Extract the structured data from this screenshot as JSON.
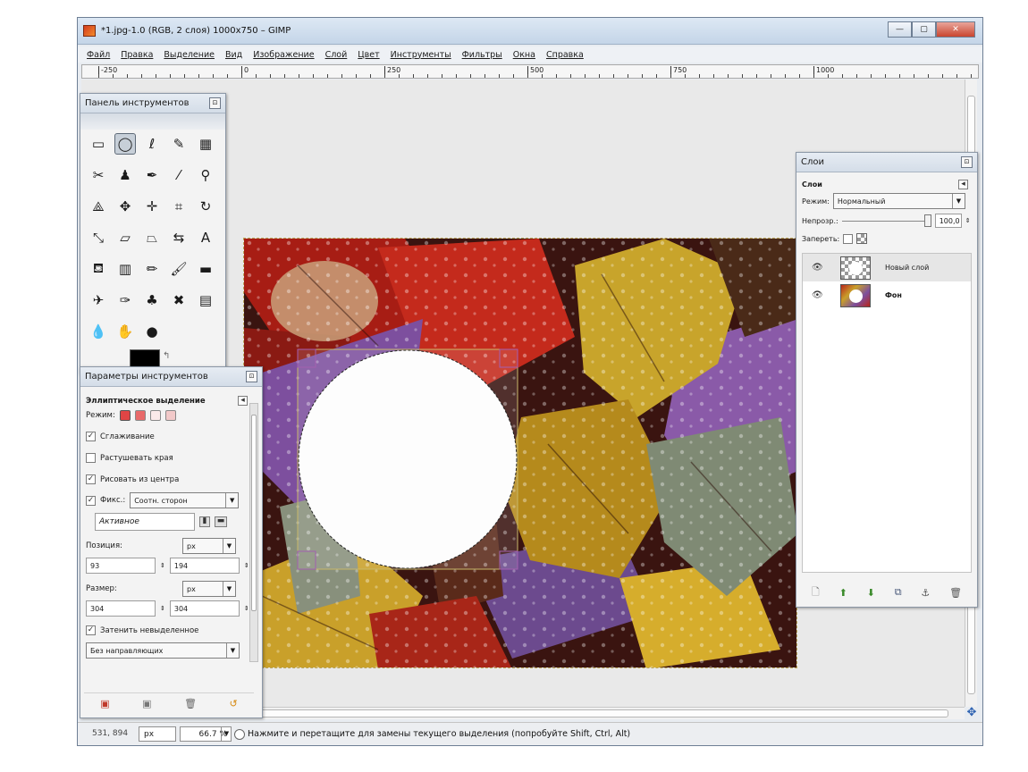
{
  "window": {
    "title": "*1.jpg-1.0 (RGB, 2 слоя) 1000x750 – GIMP",
    "minimize": "—",
    "maximize": "▢",
    "close": "✕"
  },
  "menu": [
    "Файл",
    "Правка",
    "Выделение",
    "Вид",
    "Изображение",
    "Слой",
    "Цвет",
    "Инструменты",
    "Фильтры",
    "Окна",
    "Справка"
  ],
  "ruler": {
    "labels": [
      "-250",
      "0",
      "250",
      "500",
      "750",
      "1000"
    ]
  },
  "status": {
    "coords": "531, 894",
    "unit": "px",
    "zoom": "66.7 %",
    "message": "Нажмите и перетащите для замены текущего выделения (попробуйте Shift, Ctrl, Alt)"
  },
  "toolbox": {
    "title": "Панель инструментов",
    "tools": [
      {
        "icon": "rect-select-icon",
        "glyph": "▭"
      },
      {
        "icon": "ellipse-select-icon",
        "glyph": "◯"
      },
      {
        "icon": "free-select-icon",
        "glyph": "ℓ"
      },
      {
        "icon": "fuzzy-select-icon",
        "glyph": "✎"
      },
      {
        "icon": "select-by-color-icon",
        "glyph": "▦"
      },
      {
        "icon": "scissors-icon",
        "glyph": "✂"
      },
      {
        "icon": "foreground-select-icon",
        "glyph": "♟"
      },
      {
        "icon": "paths-icon",
        "glyph": "✒"
      },
      {
        "icon": "color-picker-icon",
        "glyph": "⁄"
      },
      {
        "icon": "zoom-icon",
        "glyph": "⚲"
      },
      {
        "icon": "measure-icon",
        "glyph": "⟁"
      },
      {
        "icon": "move-icon",
        "glyph": "✥"
      },
      {
        "icon": "align-icon",
        "glyph": "✛"
      },
      {
        "icon": "crop-icon",
        "glyph": "⌗"
      },
      {
        "icon": "rotate-icon",
        "glyph": "↻"
      },
      {
        "icon": "scale-icon",
        "glyph": "⤡"
      },
      {
        "icon": "shear-icon",
        "glyph": "▱"
      },
      {
        "icon": "perspective-icon",
        "glyph": "⏢"
      },
      {
        "icon": "flip-icon",
        "glyph": "⇆"
      },
      {
        "icon": "text-icon",
        "glyph": "A"
      },
      {
        "icon": "bucket-fill-icon",
        "glyph": "⛾"
      },
      {
        "icon": "blend-icon",
        "glyph": "▥"
      },
      {
        "icon": "pencil-icon",
        "glyph": "✏"
      },
      {
        "icon": "paintbrush-icon",
        "glyph": "🖌"
      },
      {
        "icon": "eraser-icon",
        "glyph": "▬"
      },
      {
        "icon": "airbrush-icon",
        "glyph": "✈"
      },
      {
        "icon": "ink-icon",
        "glyph": "✑"
      },
      {
        "icon": "clone-icon",
        "glyph": "♣"
      },
      {
        "icon": "heal-icon",
        "glyph": "✖"
      },
      {
        "icon": "perspective-clone-icon",
        "glyph": "▤"
      },
      {
        "icon": "blur-icon",
        "glyph": "💧"
      },
      {
        "icon": "smudge-icon",
        "glyph": "✋"
      },
      {
        "icon": "dodge-burn-icon",
        "glyph": "●"
      }
    ],
    "colors": {
      "foreground": "#000000",
      "background": "#ffffff"
    }
  },
  "tool_options": {
    "title": "Параметры инструментов",
    "tool_name": "Эллиптическое выделение",
    "mode_label": "Режим:",
    "antialias": {
      "label": "Сглаживание",
      "checked": true
    },
    "feather": {
      "label": "Растушевать края",
      "checked": false
    },
    "from_center": {
      "label": "Рисовать из центра",
      "checked": true
    },
    "fixed": {
      "label": "Фикс.:",
      "checked": true,
      "value": "Соотн. сторон"
    },
    "aspect_value": "Активное",
    "position": {
      "label": "Позиция:",
      "unit": "px",
      "x": "93",
      "y": "194"
    },
    "size": {
      "label": "Размер:",
      "unit": "px",
      "w": "304",
      "h": "304"
    },
    "highlight": {
      "label": "Затенить невыделенное",
      "checked": true
    },
    "guides": "Без направляющих"
  },
  "layers": {
    "title": "Слои",
    "tab": "Слои",
    "mode_label": "Режим:",
    "mode_value": "Нормальный",
    "opacity_label": "Непрозр.:",
    "opacity_value": "100,0",
    "opacity_fraction": 1.0,
    "lock_label": "Запереть:",
    "items": [
      {
        "name": "Новый слой",
        "selected": true
      },
      {
        "name": "Фон",
        "selected": false
      }
    ]
  },
  "colors": {
    "accent": "#2a5fb0",
    "selection": "#b9a45a"
  }
}
